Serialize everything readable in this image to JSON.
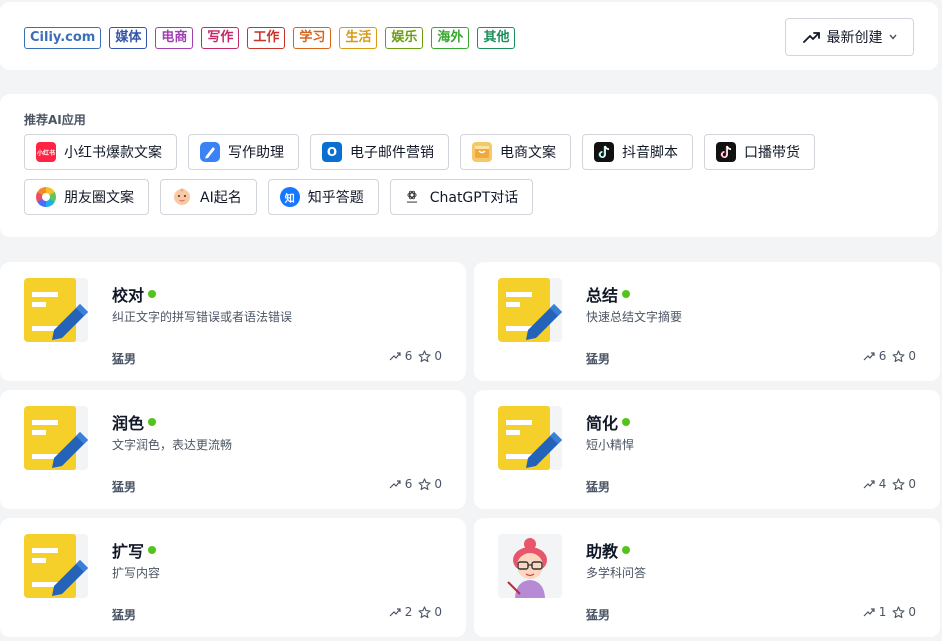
{
  "tags": [
    {
      "label": "Ciliy.com",
      "color": "#3b6fb6"
    },
    {
      "label": "媒体",
      "color": "#3553a8"
    },
    {
      "label": "电商",
      "color": "#a23fb5"
    },
    {
      "label": "写作",
      "color": "#c42a6a"
    },
    {
      "label": "工作",
      "color": "#c8332b"
    },
    {
      "label": "学习",
      "color": "#d8641a"
    },
    {
      "label": "生活",
      "color": "#d89a12"
    },
    {
      "label": "娱乐",
      "color": "#6a9d12"
    },
    {
      "label": "海外",
      "color": "#36a82d"
    },
    {
      "label": "其他",
      "color": "#1c8f5b"
    }
  ],
  "sort": {
    "label": "最新创建"
  },
  "recommend": {
    "title": "推荐AI应用",
    "items": [
      {
        "label": "小红书爆款文案",
        "icon": "xiaohongshu-icon"
      },
      {
        "label": "写作助理",
        "icon": "pen-icon"
      },
      {
        "label": "电子邮件营销",
        "icon": "outlook-icon"
      },
      {
        "label": "电商文案",
        "icon": "shop-icon"
      },
      {
        "label": "抖音脚本",
        "icon": "tiktok-icon"
      },
      {
        "label": "口播带货",
        "icon": "tiktok-icon"
      },
      {
        "label": "朋友圈文案",
        "icon": "moments-icon"
      },
      {
        "label": "AI起名",
        "icon": "baby-icon"
      },
      {
        "label": "知乎答题",
        "icon": "zhihu-icon"
      },
      {
        "label": "ChatGPT对话",
        "icon": "chatgpt-icon"
      }
    ],
    "xhs_text": "小红书",
    "zhihu_text": "知",
    "outlook_text": "O"
  },
  "cards": [
    {
      "name": "校对",
      "desc": "纠正文字的拼写错误或者语法错误",
      "author": "猛男",
      "uses": "6",
      "stars": "0",
      "thumb": "doc-pen-icon"
    },
    {
      "name": "总结",
      "desc": "快速总结文字摘要",
      "author": "猛男",
      "uses": "6",
      "stars": "0",
      "thumb": "doc-pen-icon"
    },
    {
      "name": "润色",
      "desc": "文字润色，表达更流畅",
      "author": "猛男",
      "uses": "6",
      "stars": "0",
      "thumb": "doc-pen-icon"
    },
    {
      "name": "简化",
      "desc": "短小精悍",
      "author": "猛男",
      "uses": "4",
      "stars": "0",
      "thumb": "doc-pen-icon"
    },
    {
      "name": "扩写",
      "desc": "扩写内容",
      "author": "猛男",
      "uses": "2",
      "stars": "0",
      "thumb": "doc-pen-icon"
    },
    {
      "name": "助教",
      "desc": "多学科问答",
      "author": "猛男",
      "uses": "1",
      "stars": "0",
      "thumb": "teacher-avatar-icon"
    }
  ]
}
